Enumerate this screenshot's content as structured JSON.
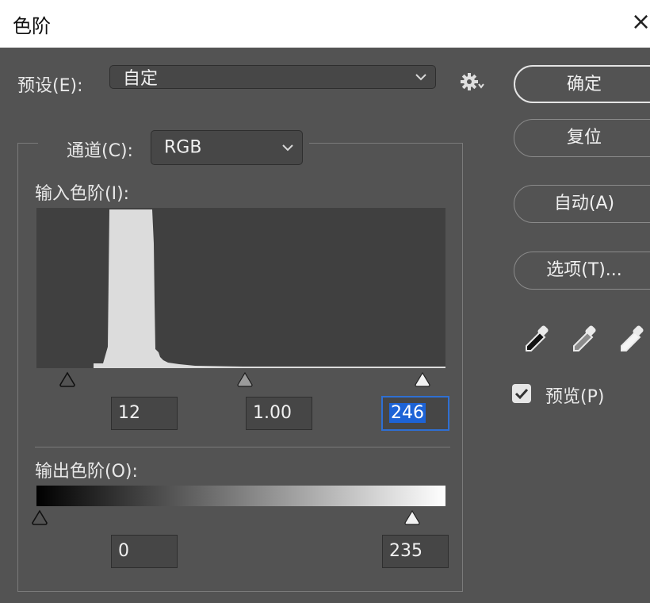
{
  "window": {
    "title": "色阶",
    "close_glyph": "×"
  },
  "preset": {
    "label": "预设(E):",
    "value": "自定"
  },
  "channel": {
    "label": "通道(C):",
    "value": "RGB"
  },
  "input_levels": {
    "label": "输入色阶(I):",
    "black_point": "12",
    "gamma": "1.00",
    "white_point": "246",
    "black_slider": 12,
    "gamma_slider_pct": 50,
    "white_slider": 246
  },
  "output_levels": {
    "label": "输出色阶(O):",
    "black_point": "0",
    "white_point": "235",
    "black_slider": 0,
    "white_slider": 235
  },
  "buttons": {
    "ok": "确定",
    "reset": "复位",
    "auto": "自动(A)",
    "options": "选项(T)..."
  },
  "eyedroppers": [
    "black-point-eyedropper-icon",
    "gray-point-eyedropper-icon",
    "white-point-eyedropper-icon"
  ],
  "preview": {
    "label": "预览(P)",
    "checked": true
  },
  "colors": {
    "panel_bg": "#535353",
    "histogram_bg": "#404040",
    "histogram_fill": "#dcdcdc",
    "focus_blue": "#1d63d6"
  }
}
